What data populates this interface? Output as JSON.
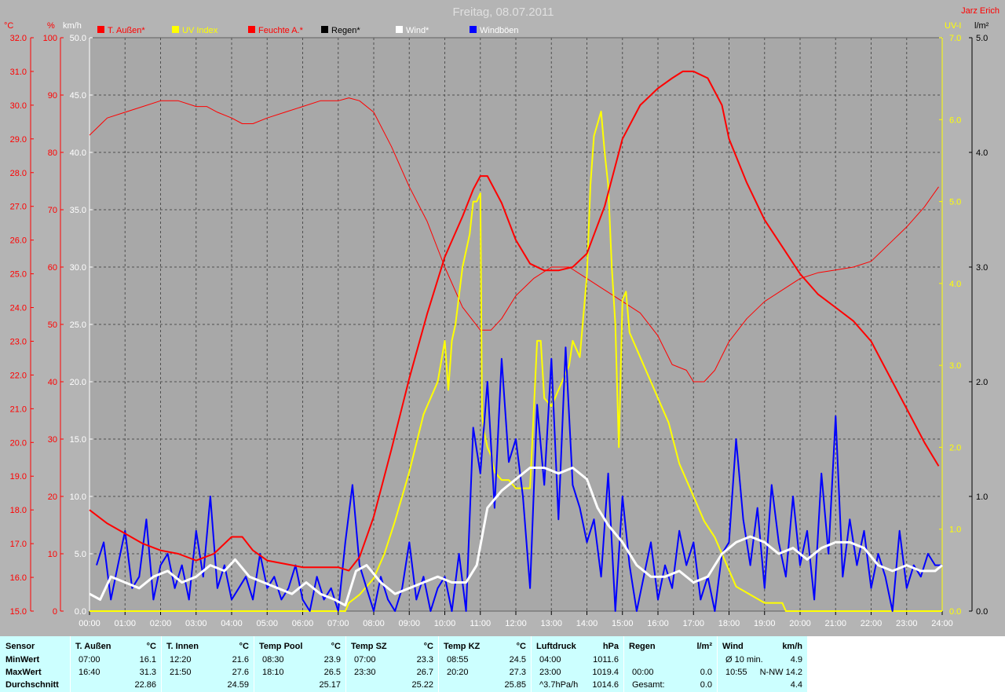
{
  "title": "Freitag, 08.07.2011",
  "author": "Jarz Erich",
  "colors": {
    "background": "#b4b4b4",
    "plot": "#a8a8a8",
    "red": "#ff0000",
    "yellow": "#ffff00",
    "blue": "#0000ff",
    "white": "#ffffff",
    "black": "#000000",
    "panel": "#ccffff"
  },
  "axis_units": {
    "temp": "°C",
    "hum": "%",
    "wind": "km/h",
    "uv": "UV-I",
    "rain": "l/m²"
  },
  "legend": [
    {
      "label": "T. Außen*",
      "color": "#ff0000",
      "text_color": "#ff0000"
    },
    {
      "label": "UV Index",
      "color": "#ffff00",
      "text_color": "#ffff00"
    },
    {
      "label": "Feuchte A.*",
      "color": "#ff0000",
      "text_color": "#ff0000"
    },
    {
      "label": "Regen*",
      "color": "#000000",
      "text_color": "#000000"
    },
    {
      "label": "Wind*",
      "color": "#ffffff",
      "text_color": "#ffffff"
    },
    {
      "label": "Windböen",
      "color": "#0000ff",
      "text_color": "#ffffff"
    }
  ],
  "chart_data": {
    "type": "line",
    "title": "Freitag, 08.07.2011",
    "x_ticks": [
      "00:00",
      "01:00",
      "02:00",
      "03:00",
      "04:00",
      "05:00",
      "06:00",
      "07:00",
      "08:00",
      "09:00",
      "10:00",
      "11:00",
      "12:00",
      "13:00",
      "14:00",
      "15:00",
      "16:00",
      "17:00",
      "18:00",
      "19:00",
      "20:00",
      "21:00",
      "22:00",
      "23:00",
      "24:00"
    ],
    "xlim": [
      0,
      24
    ],
    "grid": true,
    "legend_position": "top",
    "axes": {
      "temp": {
        "ylim": [
          15,
          32
        ],
        "ticks": [
          "15.0",
          "16.0",
          "17.0",
          "18.0",
          "19.0",
          "20.0",
          "21.0",
          "22.0",
          "23.0",
          "24.0",
          "25.0",
          "26.0",
          "27.0",
          "28.0",
          "29.0",
          "30.0",
          "31.0",
          "32.0"
        ]
      },
      "hum": {
        "ylim": [
          0,
          100
        ],
        "ticks": [
          "0",
          "10",
          "20",
          "30",
          "40",
          "50",
          "60",
          "70",
          "80",
          "90",
          "100"
        ]
      },
      "wind": {
        "ylim": [
          0,
          50
        ],
        "ticks": [
          "0.0",
          "5.0",
          "10.0",
          "15.0",
          "20.0",
          "25.0",
          "30.0",
          "35.0",
          "40.0",
          "45.0",
          "50.0"
        ]
      },
      "uv": {
        "ylim": [
          0,
          7
        ],
        "ticks": [
          "0.0",
          "1.0",
          "2.0",
          "3.0",
          "4.0",
          "5.0",
          "6.0",
          "7.0"
        ]
      },
      "rain": {
        "ylim": [
          0,
          5
        ],
        "ticks": [
          "0.0",
          "1.0",
          "2.0",
          "3.0",
          "4.0",
          "5.0"
        ]
      }
    },
    "series": [
      {
        "name": "T. Außen*",
        "axis": "temp",
        "color": "#ff0000",
        "width": 2,
        "x": [
          0,
          0.5,
          1,
          1.5,
          2,
          2.5,
          3,
          3.5,
          4,
          4.3,
          4.6,
          5,
          5.5,
          6,
          6.5,
          7,
          7.3,
          7.6,
          8,
          8.5,
          9,
          9.5,
          10,
          10.5,
          10.8,
          11,
          11.2,
          11.6,
          12,
          12.4,
          12.8,
          13.2,
          13.6,
          14,
          14.5,
          15,
          15.5,
          16,
          16.4,
          16.7,
          17,
          17.4,
          17.8,
          18,
          18.5,
          19,
          19.5,
          20,
          20.5,
          21,
          21.5,
          22,
          22.5,
          23,
          23.5,
          23.9
        ],
        "y": [
          18.0,
          17.6,
          17.3,
          17.0,
          16.8,
          16.7,
          16.5,
          16.7,
          17.2,
          17.2,
          16.8,
          16.5,
          16.4,
          16.3,
          16.3,
          16.3,
          16.2,
          16.6,
          17.8,
          19.8,
          21.9,
          23.8,
          25.5,
          26.7,
          27.5,
          27.9,
          27.9,
          27.1,
          26.0,
          25.3,
          25.1,
          25.1,
          25.2,
          25.6,
          27.0,
          29.0,
          30.0,
          30.5,
          30.8,
          31.0,
          31.0,
          30.8,
          30.0,
          29.0,
          27.7,
          26.6,
          25.8,
          25.0,
          24.4,
          24.0,
          23.6,
          23.0,
          22.0,
          21.0,
          20.0,
          19.3
        ]
      },
      {
        "name": "Feuchte A.*",
        "axis": "hum",
        "color": "#ff0000",
        "width": 1,
        "x": [
          0,
          0.5,
          1,
          1.5,
          2,
          2.5,
          3,
          3.3,
          3.6,
          4,
          4.3,
          4.6,
          5,
          5.5,
          6,
          6.5,
          7,
          7.3,
          7.6,
          8,
          8.5,
          9,
          9.5,
          10,
          10.5,
          11,
          11.3,
          11.6,
          12,
          12.5,
          13,
          13.5,
          14,
          14.5,
          15,
          15.5,
          16,
          16.4,
          16.8,
          17,
          17.3,
          17.6,
          18,
          18.5,
          19,
          19.5,
          20,
          20.5,
          21,
          21.5,
          22,
          22.5,
          23,
          23.5,
          23.9
        ],
        "y": [
          83,
          86,
          87,
          88,
          89,
          89,
          88,
          88,
          87,
          86,
          85,
          85,
          86,
          87,
          88,
          89,
          89,
          89.5,
          89,
          87,
          81,
          74,
          68,
          60,
          53,
          49,
          49,
          51,
          55,
          58,
          60,
          60,
          58,
          56,
          54,
          52,
          48,
          43,
          42,
          40,
          40,
          42,
          47,
          51,
          54,
          56,
          58,
          59,
          59.5,
          60,
          61,
          64,
          67,
          70.5,
          74
        ]
      },
      {
        "name": "UV Index",
        "axis": "uv",
        "color": "#ffff00",
        "width": 2,
        "x": [
          0,
          7.2,
          7.3,
          7.6,
          8,
          8.3,
          8.6,
          9,
          9.4,
          9.8,
          10,
          10.1,
          10.2,
          10.3,
          10.5,
          10.7,
          10.8,
          10.9,
          11,
          11.05,
          11.1,
          11.2,
          11.3,
          11.4,
          11.6,
          11.8,
          12,
          12.2,
          12.4,
          12.6,
          12.7,
          12.8,
          13,
          13.2,
          13.5,
          13.6,
          13.8,
          14,
          14.1,
          14.2,
          14.4,
          14.5,
          14.6,
          14.7,
          14.8,
          14.9,
          15,
          15.1,
          15.2,
          15.4,
          15.6,
          15.8,
          16,
          16.1,
          16.3,
          16.6,
          17,
          17.3,
          17.6,
          18,
          18.2,
          18.6,
          19,
          19.2,
          19.5,
          19.6,
          24
        ],
        "y": [
          0,
          0,
          0.1,
          0.2,
          0.4,
          0.7,
          1.1,
          1.7,
          2.4,
          2.8,
          3.3,
          2.7,
          3.3,
          3.5,
          4.2,
          4.6,
          5.0,
          5.0,
          5.1,
          2.4,
          2.2,
          2.0,
          1.9,
          1.7,
          1.6,
          1.6,
          1.5,
          1.5,
          1.5,
          3.3,
          3.3,
          2.6,
          2.5,
          2.7,
          3.0,
          3.3,
          3.1,
          4.1,
          5.2,
          5.8,
          6.1,
          5.6,
          5.2,
          4.2,
          3.5,
          2.0,
          3.8,
          3.9,
          3.4,
          3.2,
          3.0,
          2.8,
          2.6,
          2.5,
          2.3,
          1.8,
          1.4,
          1.1,
          0.9,
          0.5,
          0.3,
          0.2,
          0.1,
          0.1,
          0.1,
          0,
          0
        ]
      },
      {
        "name": "Windböen",
        "axis": "wind",
        "color": "#0000ff",
        "width": 2,
        "x": [
          0.2,
          0.4,
          0.6,
          0.8,
          1.0,
          1.2,
          1.4,
          1.6,
          1.8,
          2.0,
          2.2,
          2.4,
          2.6,
          2.8,
          3.0,
          3.2,
          3.4,
          3.6,
          3.8,
          4.0,
          4.2,
          4.4,
          4.6,
          4.8,
          5.0,
          5.2,
          5.4,
          5.6,
          5.8,
          6.0,
          6.2,
          6.4,
          6.6,
          6.8,
          7.0,
          7.2,
          7.4,
          7.6,
          7.8,
          8.0,
          8.2,
          8.4,
          8.6,
          8.8,
          9.0,
          9.2,
          9.4,
          9.6,
          9.8,
          10.0,
          10.2,
          10.4,
          10.6,
          10.8,
          11.0,
          11.2,
          11.4,
          11.6,
          11.8,
          12.0,
          12.2,
          12.4,
          12.6,
          12.8,
          13.0,
          13.2,
          13.4,
          13.6,
          13.8,
          14.0,
          14.2,
          14.4,
          14.6,
          14.8,
          15.0,
          15.2,
          15.4,
          15.6,
          15.8,
          16.0,
          16.2,
          16.4,
          16.6,
          16.8,
          17.0,
          17.2,
          17.4,
          17.6,
          17.8,
          18.0,
          18.2,
          18.4,
          18.6,
          18.8,
          19.0,
          19.2,
          19.4,
          19.6,
          19.8,
          20.0,
          20.2,
          20.4,
          20.6,
          20.8,
          21.0,
          21.2,
          21.4,
          21.6,
          21.8,
          22.0,
          22.2,
          22.4,
          22.6,
          22.8,
          23.0,
          23.2,
          23.4,
          23.6,
          23.8,
          24.0
        ],
        "y": [
          4,
          6,
          1,
          4,
          7,
          2,
          3,
          8,
          1,
          4,
          5,
          2,
          4,
          1,
          7,
          3,
          10,
          2,
          4,
          1,
          2,
          3,
          1,
          5,
          2,
          3,
          1,
          2,
          4,
          1,
          0,
          3,
          1,
          2,
          0,
          6,
          11,
          4,
          2,
          0,
          3,
          1,
          0,
          2,
          6,
          1,
          3,
          0,
          2,
          3,
          0,
          5,
          0,
          16,
          12,
          20,
          9,
          22,
          13,
          15,
          10,
          2,
          18,
          11,
          22,
          8,
          23,
          11,
          9,
          6,
          8,
          3,
          12,
          0,
          10,
          4,
          0,
          3,
          6,
          1,
          4,
          2,
          7,
          4,
          6,
          1,
          3,
          0,
          5,
          6,
          15,
          8,
          4,
          9,
          2,
          11,
          6,
          3,
          10,
          4,
          7,
          1,
          12,
          5,
          17,
          3,
          8,
          4,
          7,
          2,
          5,
          3,
          0,
          7,
          2,
          4,
          3,
          5,
          4,
          4
        ]
      },
      {
        "name": "Wind*",
        "axis": "wind",
        "color": "#ffffff",
        "width": 3,
        "x": [
          0,
          0.3,
          0.6,
          1,
          1.4,
          1.8,
          2.2,
          2.6,
          3,
          3.4,
          3.8,
          4.1,
          4.5,
          4.9,
          5.3,
          5.7,
          6.1,
          6.5,
          6.9,
          7.2,
          7.5,
          7.8,
          8.2,
          8.6,
          9,
          9.4,
          9.8,
          10.2,
          10.6,
          10.9,
          11.2,
          11.6,
          12,
          12.4,
          12.8,
          13.2,
          13.6,
          14,
          14.3,
          14.6,
          15,
          15.4,
          15.8,
          16.2,
          16.6,
          17,
          17.4,
          17.8,
          18.2,
          18.6,
          19,
          19.4,
          19.8,
          20.2,
          20.6,
          21,
          21.4,
          21.8,
          22.2,
          22.6,
          23,
          23.4,
          23.8,
          24
        ],
        "y": [
          1.5,
          1,
          3,
          2.5,
          2,
          3,
          3.5,
          2.5,
          3,
          4,
          3.5,
          4.5,
          3,
          2.5,
          2,
          1.5,
          2.5,
          1.5,
          1,
          0.5,
          3.5,
          4,
          2.5,
          1.5,
          2,
          2.5,
          3,
          2.5,
          2.5,
          4,
          9,
          10.5,
          11.5,
          12.5,
          12.5,
          12,
          12.5,
          11.5,
          9,
          7.5,
          6,
          4,
          3,
          3,
          3.5,
          2.5,
          3,
          5,
          6,
          6.5,
          6,
          5,
          5.5,
          4.5,
          5.5,
          6,
          6,
          5.5,
          4,
          3.5,
          4,
          3.5,
          3.5,
          4
        ]
      }
    ]
  },
  "stats": {
    "sensor": {
      "header": "Sensor",
      "rows": [
        "MinWert",
        "MaxWert",
        "Durchschnitt"
      ]
    },
    "blocks": [
      {
        "name": "T. Außen",
        "unit": "°C",
        "min_time": "07:00",
        "min_val": "16.1",
        "max_time": "16:40",
        "max_val": "31.3",
        "avg_time": "",
        "avg_val": "22.86"
      },
      {
        "name": "T. Innen",
        "unit": "°C",
        "min_time": "12:20",
        "min_val": "21.6",
        "max_time": "21:50",
        "max_val": "27.6",
        "avg_time": "",
        "avg_val": "24.59"
      },
      {
        "name": "Temp Pool",
        "unit": "°C",
        "min_time": "08:30",
        "min_val": "23.9",
        "max_time": "18:10",
        "max_val": "26.5",
        "avg_time": "",
        "avg_val": "25.17"
      },
      {
        "name": "Temp SZ",
        "unit": "°C",
        "min_time": "07:00",
        "min_val": "23.3",
        "max_time": "23:30",
        "max_val": "26.7",
        "avg_time": "",
        "avg_val": "25.22"
      },
      {
        "name": "Temp KZ",
        "unit": "°C",
        "min_time": "08:55",
        "min_val": "24.5",
        "max_time": "20:20",
        "max_val": "27.3",
        "avg_time": "",
        "avg_val": "25.85"
      },
      {
        "name": "Luftdruck",
        "unit": "hPa",
        "min_time": "04:00",
        "min_val": "1011.6",
        "max_time": "23:00",
        "max_val": "1019.4",
        "avg_time": "^3.7hPa/h",
        "avg_val": "1014.6"
      },
      {
        "name": "Regen",
        "unit": "l/m²",
        "min_time": "",
        "min_val": "",
        "max_time": "00:00",
        "max_val": "0.0",
        "avg_time": "Gesamt:",
        "avg_val": "0.0"
      },
      {
        "name": "Wind",
        "unit": "km/h",
        "min_time": "Ø 10 min.",
        "min_val": "4.9",
        "max_time": "10:55",
        "max_val": "N-NW 14.2",
        "avg_time": "",
        "avg_val": "4.4"
      }
    ]
  }
}
